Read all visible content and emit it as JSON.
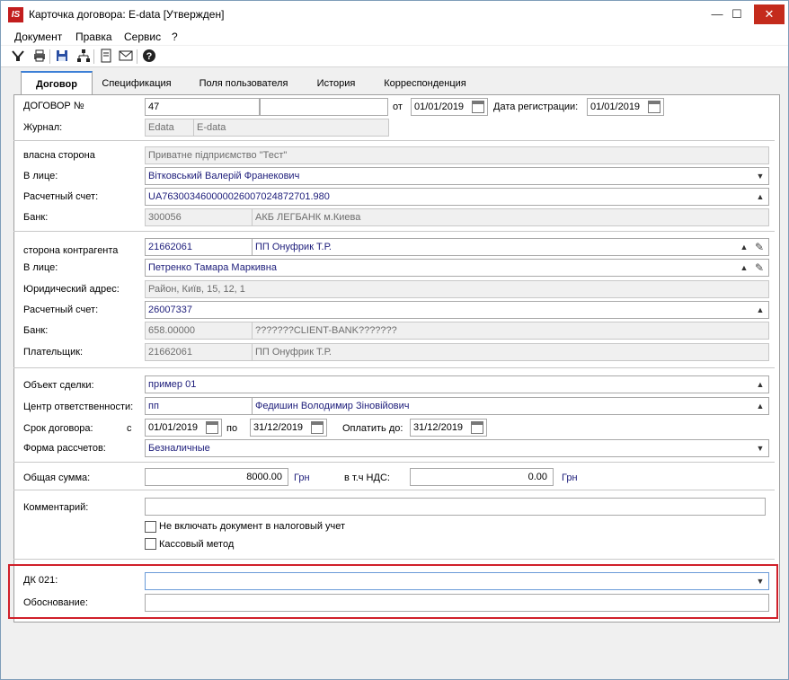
{
  "window": {
    "title": "Карточка договора:  E-data [Утвержден]",
    "app_icon_text": "IS",
    "min": "—",
    "max": "☐",
    "close": "✕"
  },
  "menu": [
    "Документ",
    "Правка",
    "Сервис",
    "?"
  ],
  "toolbar": {
    "icons": [
      "filter-icon",
      "print-icon",
      "save-icon",
      "tree-icon",
      "document-icon",
      "mail-icon",
      "help-icon"
    ]
  },
  "tabs": [
    "Договор",
    "Спецификация",
    "Поля пользователя",
    "История",
    "Корреспонденция"
  ],
  "header": {
    "contract_no_label": "ДОГОВОР №",
    "contract_no": "47",
    "contract_no_extra": "",
    "from_label": "от",
    "date": "01/01/2019",
    "reg_date_label": "Дата регистрации:",
    "reg_date": "01/01/2019",
    "journal_label": "Журнал:",
    "journal_code": "Edata",
    "journal_name": "E-data"
  },
  "own_party": {
    "label": "власна сторона",
    "value": "Приватне підприємство \"Тест\"",
    "person_label": "В лице:",
    "person": "Вітковський Валерій Франекович",
    "account_label": "Расчетный счет:",
    "account": "UA763003460000026007024872701.980",
    "bank_label": "Банк:",
    "bank_code": "300056",
    "bank_name": "АКБ ЛЕГБАНК м.Киева"
  },
  "counterparty": {
    "label": "сторона контрагента",
    "code": "21662061",
    "name": "ПП Онуфрик Т.Р.",
    "person_label": "В лице:",
    "person": "Петренко Тамара Маркивна",
    "address_label": "Юридический адрес:",
    "address": "Район, Київ, 15, 12, 1",
    "account_label": "Расчетный счет:",
    "account": "26007337",
    "bank_label": "Банк:",
    "bank_code": "658.00000",
    "bank_name": "???????CLIENT-BANK???????",
    "payer_label": "Плательщик:",
    "payer_code": "21662061",
    "payer_name": "ПП Онуфрик Т.Р."
  },
  "deal": {
    "object_label": "Объект сделки:",
    "object": "пример 01",
    "center_label": "Центр ответственности:",
    "center_code": "пп",
    "center_name": "Федишин Володимир Зіновійович",
    "term_label": "Срок договора:",
    "from_label": "с",
    "term_from": "01/01/2019",
    "to_label": "по",
    "term_to": "31/12/2019",
    "pay_until_label": "Оплатить до:",
    "pay_until": "31/12/2019",
    "payment_form_label": "Форма рассчетов:",
    "payment_form": "Безналичные"
  },
  "sum": {
    "total_label": "Общая сумма:",
    "total": "8000.00",
    "currency": "Грн",
    "vat_label": "в т.ч НДС:",
    "vat": "0.00",
    "vat_currency": "Грн"
  },
  "comment": {
    "label": "Комментарий:",
    "value": "",
    "check1_label": "Не включать документ в налоговый учет",
    "check2_label": "Кассовый метод"
  },
  "dk": {
    "dk_label": "ДК 021:",
    "dk_value": "",
    "reason_label": "Обоснование:",
    "reason_value": ""
  }
}
